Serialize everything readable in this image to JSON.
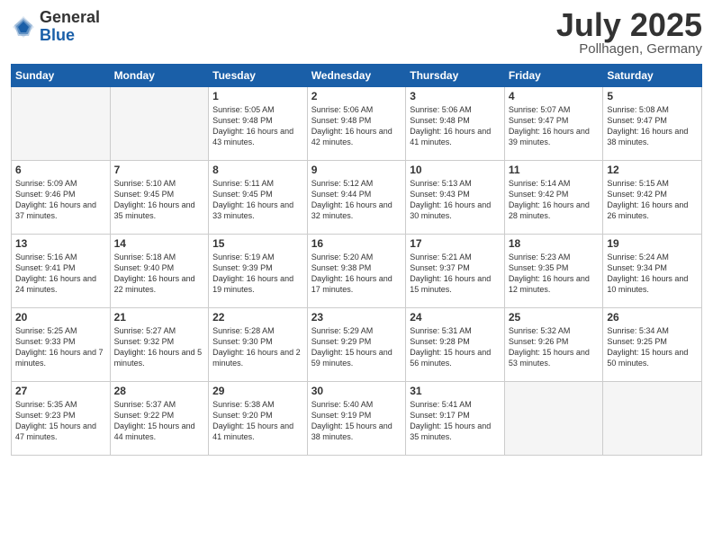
{
  "logo": {
    "general": "General",
    "blue": "Blue"
  },
  "title": "July 2025",
  "subtitle": "Pollhagen, Germany",
  "days_of_week": [
    "Sunday",
    "Monday",
    "Tuesday",
    "Wednesday",
    "Thursday",
    "Friday",
    "Saturday"
  ],
  "weeks": [
    [
      {
        "num": "",
        "sunrise": "",
        "sunset": "",
        "daylight": "",
        "empty": true
      },
      {
        "num": "",
        "sunrise": "",
        "sunset": "",
        "daylight": "",
        "empty": true
      },
      {
        "num": "1",
        "sunrise": "Sunrise: 5:05 AM",
        "sunset": "Sunset: 9:48 PM",
        "daylight": "Daylight: 16 hours and 43 minutes."
      },
      {
        "num": "2",
        "sunrise": "Sunrise: 5:06 AM",
        "sunset": "Sunset: 9:48 PM",
        "daylight": "Daylight: 16 hours and 42 minutes."
      },
      {
        "num": "3",
        "sunrise": "Sunrise: 5:06 AM",
        "sunset": "Sunset: 9:48 PM",
        "daylight": "Daylight: 16 hours and 41 minutes."
      },
      {
        "num": "4",
        "sunrise": "Sunrise: 5:07 AM",
        "sunset": "Sunset: 9:47 PM",
        "daylight": "Daylight: 16 hours and 39 minutes."
      },
      {
        "num": "5",
        "sunrise": "Sunrise: 5:08 AM",
        "sunset": "Sunset: 9:47 PM",
        "daylight": "Daylight: 16 hours and 38 minutes."
      }
    ],
    [
      {
        "num": "6",
        "sunrise": "Sunrise: 5:09 AM",
        "sunset": "Sunset: 9:46 PM",
        "daylight": "Daylight: 16 hours and 37 minutes."
      },
      {
        "num": "7",
        "sunrise": "Sunrise: 5:10 AM",
        "sunset": "Sunset: 9:45 PM",
        "daylight": "Daylight: 16 hours and 35 minutes."
      },
      {
        "num": "8",
        "sunrise": "Sunrise: 5:11 AM",
        "sunset": "Sunset: 9:45 PM",
        "daylight": "Daylight: 16 hours and 33 minutes."
      },
      {
        "num": "9",
        "sunrise": "Sunrise: 5:12 AM",
        "sunset": "Sunset: 9:44 PM",
        "daylight": "Daylight: 16 hours and 32 minutes."
      },
      {
        "num": "10",
        "sunrise": "Sunrise: 5:13 AM",
        "sunset": "Sunset: 9:43 PM",
        "daylight": "Daylight: 16 hours and 30 minutes."
      },
      {
        "num": "11",
        "sunrise": "Sunrise: 5:14 AM",
        "sunset": "Sunset: 9:42 PM",
        "daylight": "Daylight: 16 hours and 28 minutes."
      },
      {
        "num": "12",
        "sunrise": "Sunrise: 5:15 AM",
        "sunset": "Sunset: 9:42 PM",
        "daylight": "Daylight: 16 hours and 26 minutes."
      }
    ],
    [
      {
        "num": "13",
        "sunrise": "Sunrise: 5:16 AM",
        "sunset": "Sunset: 9:41 PM",
        "daylight": "Daylight: 16 hours and 24 minutes."
      },
      {
        "num": "14",
        "sunrise": "Sunrise: 5:18 AM",
        "sunset": "Sunset: 9:40 PM",
        "daylight": "Daylight: 16 hours and 22 minutes."
      },
      {
        "num": "15",
        "sunrise": "Sunrise: 5:19 AM",
        "sunset": "Sunset: 9:39 PM",
        "daylight": "Daylight: 16 hours and 19 minutes."
      },
      {
        "num": "16",
        "sunrise": "Sunrise: 5:20 AM",
        "sunset": "Sunset: 9:38 PM",
        "daylight": "Daylight: 16 hours and 17 minutes."
      },
      {
        "num": "17",
        "sunrise": "Sunrise: 5:21 AM",
        "sunset": "Sunset: 9:37 PM",
        "daylight": "Daylight: 16 hours and 15 minutes."
      },
      {
        "num": "18",
        "sunrise": "Sunrise: 5:23 AM",
        "sunset": "Sunset: 9:35 PM",
        "daylight": "Daylight: 16 hours and 12 minutes."
      },
      {
        "num": "19",
        "sunrise": "Sunrise: 5:24 AM",
        "sunset": "Sunset: 9:34 PM",
        "daylight": "Daylight: 16 hours and 10 minutes."
      }
    ],
    [
      {
        "num": "20",
        "sunrise": "Sunrise: 5:25 AM",
        "sunset": "Sunset: 9:33 PM",
        "daylight": "Daylight: 16 hours and 7 minutes."
      },
      {
        "num": "21",
        "sunrise": "Sunrise: 5:27 AM",
        "sunset": "Sunset: 9:32 PM",
        "daylight": "Daylight: 16 hours and 5 minutes."
      },
      {
        "num": "22",
        "sunrise": "Sunrise: 5:28 AM",
        "sunset": "Sunset: 9:30 PM",
        "daylight": "Daylight: 16 hours and 2 minutes."
      },
      {
        "num": "23",
        "sunrise": "Sunrise: 5:29 AM",
        "sunset": "Sunset: 9:29 PM",
        "daylight": "Daylight: 15 hours and 59 minutes."
      },
      {
        "num": "24",
        "sunrise": "Sunrise: 5:31 AM",
        "sunset": "Sunset: 9:28 PM",
        "daylight": "Daylight: 15 hours and 56 minutes."
      },
      {
        "num": "25",
        "sunrise": "Sunrise: 5:32 AM",
        "sunset": "Sunset: 9:26 PM",
        "daylight": "Daylight: 15 hours and 53 minutes."
      },
      {
        "num": "26",
        "sunrise": "Sunrise: 5:34 AM",
        "sunset": "Sunset: 9:25 PM",
        "daylight": "Daylight: 15 hours and 50 minutes."
      }
    ],
    [
      {
        "num": "27",
        "sunrise": "Sunrise: 5:35 AM",
        "sunset": "Sunset: 9:23 PM",
        "daylight": "Daylight: 15 hours and 47 minutes."
      },
      {
        "num": "28",
        "sunrise": "Sunrise: 5:37 AM",
        "sunset": "Sunset: 9:22 PM",
        "daylight": "Daylight: 15 hours and 44 minutes."
      },
      {
        "num": "29",
        "sunrise": "Sunrise: 5:38 AM",
        "sunset": "Sunset: 9:20 PM",
        "daylight": "Daylight: 15 hours and 41 minutes."
      },
      {
        "num": "30",
        "sunrise": "Sunrise: 5:40 AM",
        "sunset": "Sunset: 9:19 PM",
        "daylight": "Daylight: 15 hours and 38 minutes."
      },
      {
        "num": "31",
        "sunrise": "Sunrise: 5:41 AM",
        "sunset": "Sunset: 9:17 PM",
        "daylight": "Daylight: 15 hours and 35 minutes."
      },
      {
        "num": "",
        "sunrise": "",
        "sunset": "",
        "daylight": "",
        "empty": true
      },
      {
        "num": "",
        "sunrise": "",
        "sunset": "",
        "daylight": "",
        "empty": true
      }
    ]
  ]
}
